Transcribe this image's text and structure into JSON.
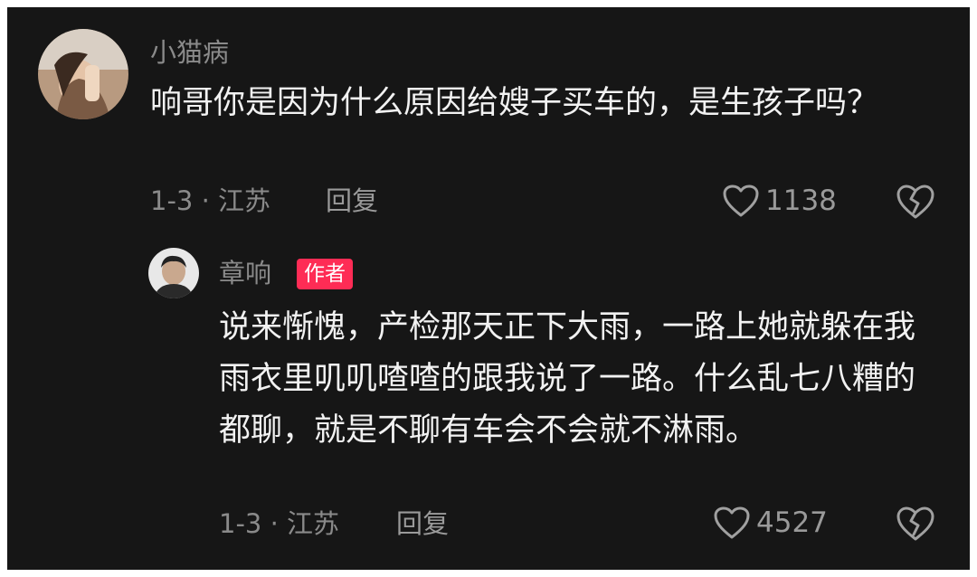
{
  "comments": [
    {
      "username": "小猫病",
      "text": "响哥你是因为什么原因给嫂子买车的，是生孩子吗？",
      "meta": "1-3 · 江苏",
      "reply_label": "回复",
      "likes": "1138",
      "avatar_icon": "user-photo-avatar"
    },
    {
      "username": "章响",
      "badge": "作者",
      "text": "说来惭愧，产检那天正下大雨，一路上她就躲在我雨衣里叽叽喳喳的跟我说了一路。什么乱七八糟的都聊，就是不聊有车会不会就不淋雨。",
      "meta": "1-3 · 江苏",
      "reply_label": "回复",
      "likes": "4527",
      "avatar_icon": "user-photo-avatar"
    }
  ],
  "icons": {
    "like": "heart-outline-icon",
    "dislike": "broken-heart-icon"
  },
  "colors": {
    "background": "#161616",
    "badge": "#fe2c55",
    "text": "#f2f2f2",
    "muted": "#8a8a8a"
  }
}
